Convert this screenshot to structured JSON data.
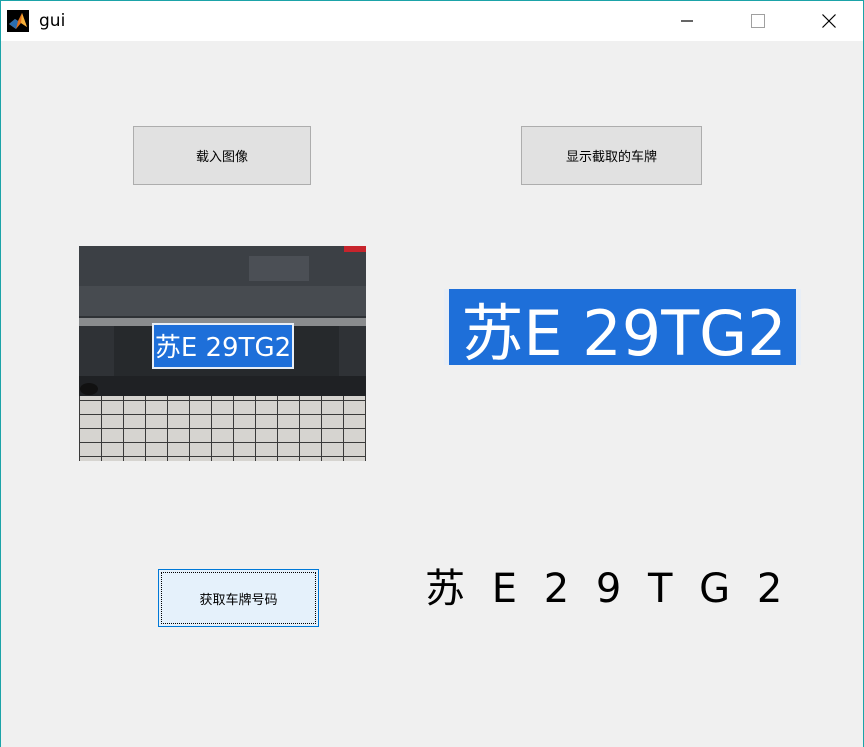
{
  "window": {
    "title": "gui",
    "icon": "matlab-logo-icon",
    "controls": [
      "minimize-icon",
      "maximize-icon",
      "close-icon"
    ]
  },
  "buttons": {
    "load_image": "载入图像",
    "show_plate": "显示截取的车牌",
    "get_plate_number": "获取车牌号码"
  },
  "images": {
    "car_photo_plate_text": "苏E 29TG2",
    "cropped_plate_text": "苏E 29TG2"
  },
  "result": {
    "plate_number": "苏 E 2 9 T G 2"
  },
  "colors": {
    "window_border": "#1ba3a8",
    "client_background": "#f0f0f0",
    "plate_blue": "#1e6fd9",
    "focused_button_border": "#0078d7"
  }
}
